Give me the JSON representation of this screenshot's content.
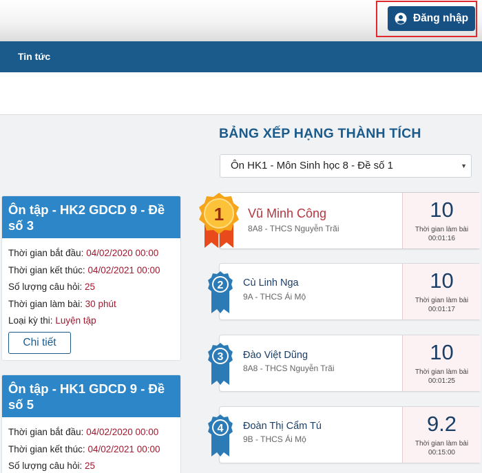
{
  "header": {
    "login_label": "Đăng nhập",
    "login_icon": "user-circle-icon"
  },
  "nav": {
    "items": [
      {
        "label": "Tin tức"
      }
    ]
  },
  "exams": [
    {
      "title": "Ôn tập - HK2 GDCD 9 - Đề số 3",
      "start_label": "Thời gian bắt đầu:",
      "start_value": "04/02/2020 00:00",
      "end_label": "Thời gian kết thúc:",
      "end_value": "04/02/2021 00:00",
      "count_label": "Số lượng câu hỏi:",
      "count_value": "25",
      "duration_label": "Thời gian làm bài:",
      "duration_value": "30 phút",
      "type_label": "Loại kỳ thi:",
      "type_value": "Luyện tập",
      "detail_label": "Chi tiết"
    },
    {
      "title": "Ôn tập - HK1 GDCD 9 - Đề số 5",
      "start_label": "Thời gian bắt đầu:",
      "start_value": "04/02/2020 00:00",
      "end_label": "Thời gian kết thúc:",
      "end_value": "04/02/2021 00:00",
      "count_label": "Số lượng câu hỏi:",
      "count_value": "25"
    }
  ],
  "leaderboard": {
    "title": "BẢNG XẾP HẠNG THÀNH TÍCH",
    "selected_exam": "Ôn HK1 - Môn Sinh học 8 - Đề số 1",
    "time_label": "Thời gian làm bài",
    "entries": [
      {
        "rank": "1",
        "name": "Vũ Minh Công",
        "school": "8A8 - THCS Nguyễn Trãi",
        "score": "10",
        "time": "00:01:16"
      },
      {
        "rank": "2",
        "name": "Cù Linh Nga",
        "school": "9A - THCS Ái Mộ",
        "score": "10",
        "time": "00:01:17"
      },
      {
        "rank": "3",
        "name": "Đào Việt Dũng",
        "school": "8A8 - THCS Nguyễn Trãi",
        "score": "10",
        "time": "00:01:25"
      },
      {
        "rank": "4",
        "name": "Đoàn Thị Cẩm Tú",
        "school": "9B - THCS Ái Mộ",
        "score": "9.2",
        "time": "00:15:00"
      }
    ]
  },
  "colors": {
    "primary": "#1b5b8c",
    "card_header": "#2c86c7",
    "accent_value": "#a0182e",
    "gold": "#f6a51b",
    "ribbon_red": "#e84a1c"
  }
}
